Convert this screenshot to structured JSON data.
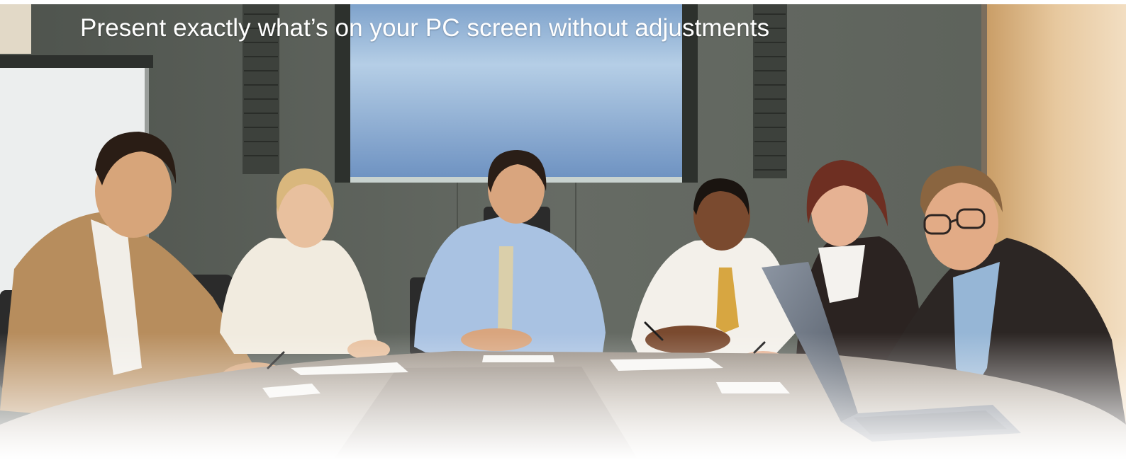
{
  "banner": {
    "headline": "Present exactly what’s on your PC screen without adjustments",
    "headline_color": "#ffffff"
  },
  "photo": {
    "subject": "business-meeting-photo",
    "wall_color": "#5f645d",
    "screen_color": "#8fb2d6",
    "table_color": "#b9ad9f"
  }
}
